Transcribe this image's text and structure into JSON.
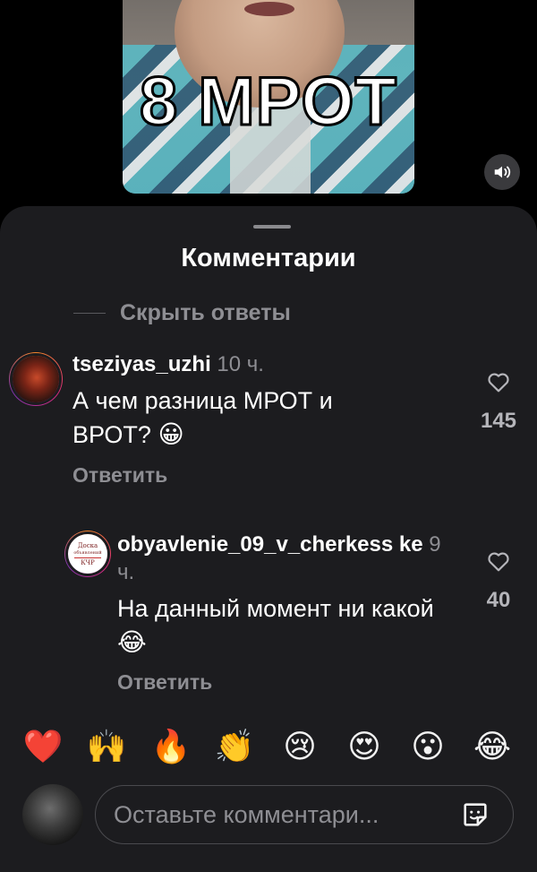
{
  "video": {
    "caption": "8 МРОТ",
    "sound_icon": "speaker-volume-icon"
  },
  "sheet": {
    "title": "Комментарии",
    "hide_replies": "Скрыть ответы"
  },
  "comments": [
    {
      "username": "tseziyas_uzhi",
      "time": "10 ч.",
      "text": "А чем разница МРОТ и ВРОТ?",
      "emoji": "😀",
      "reply_label": "Ответить",
      "likes": "145"
    },
    {
      "username": "obyavlenie_09_v_cherkess ke",
      "time": "9 ч.",
      "text": "На данный момент ни какой",
      "emoji": "😂",
      "reply_label": "Ответить",
      "likes": "40",
      "avatar_text": [
        "Доска",
        "объявлений",
        "КЧР"
      ]
    }
  ],
  "reactions": [
    "❤️",
    "🙌",
    "🔥",
    "👏",
    "😢",
    "😍",
    "😮",
    "😂"
  ],
  "input": {
    "placeholder": "Оставьте комментари..."
  },
  "colors": {
    "sheet_bg": "#1c1c1f",
    "secondary_text": "#8e8e93",
    "primary_text": "#ffffff"
  }
}
